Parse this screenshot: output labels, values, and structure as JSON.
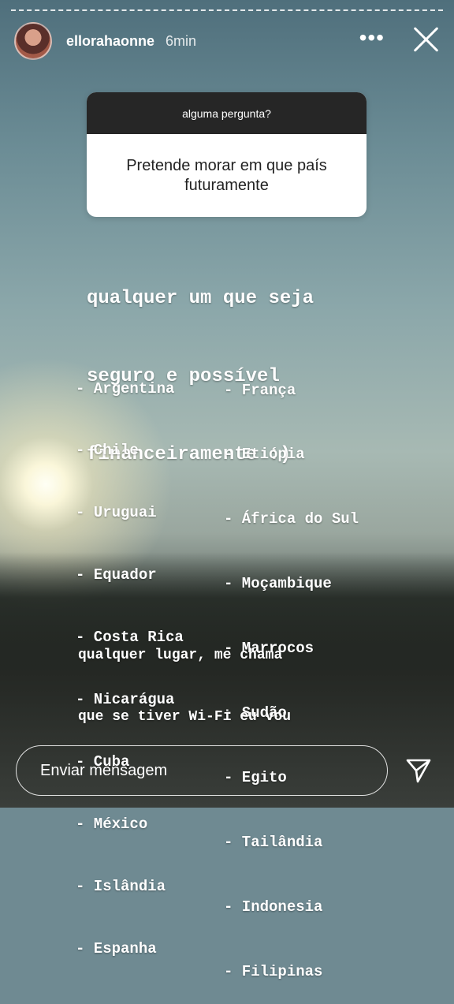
{
  "header": {
    "username": "ellorahaonne",
    "time": "6min",
    "more_icon": "more-dots-icon",
    "close_icon": "close-icon"
  },
  "question_sticker": {
    "header": "alguma pergunta?",
    "question": "Pretende morar em que país futuramente"
  },
  "answer": {
    "lines": [
      "qualquer um que seja",
      "seguro e possível",
      "financeiramente :)"
    ]
  },
  "countries_left": [
    "- Argentina",
    "- Chile",
    "- Uruguai",
    "- Equador",
    "- Costa Rica",
    "- Nicarágua",
    "- Cuba",
    "- México",
    "- Islândia",
    "- Espanha"
  ],
  "countries_right": [
    "- França",
    "- Etiópia",
    "- África do Sul",
    "- Moçambique",
    "- Marrocos",
    "- Sudão",
    "- Egito",
    "- Tailândia",
    "- Indonesia",
    "- Filipinas"
  ],
  "footer_text": {
    "line1": "qualquer lugar, me chama",
    "line2": "que se tiver Wi-Fi eu vou"
  },
  "message_bar": {
    "placeholder": "Enviar mensagem",
    "send_icon": "send-icon"
  }
}
